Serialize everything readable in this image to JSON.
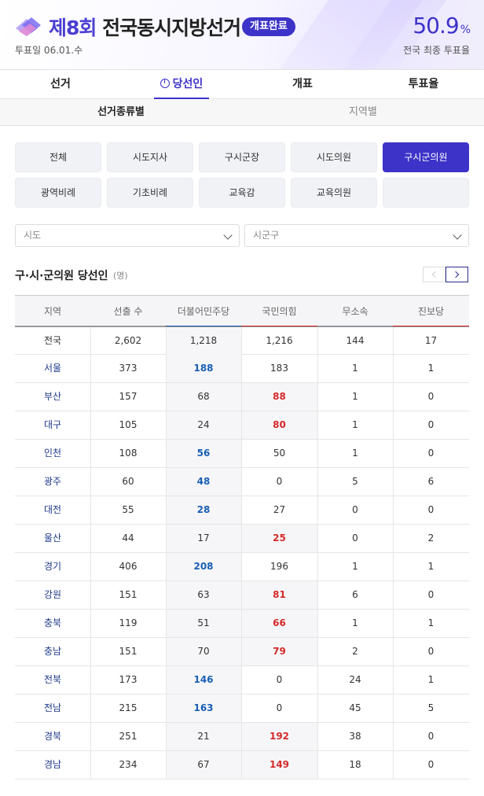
{
  "header": {
    "title_num": "제8회",
    "title_rest": " 전국동시지방선거",
    "badge": "개표완료",
    "vote_date": "투표일 06.01.수",
    "turnout_value": "50.9",
    "turnout_unit": "%",
    "turnout_label": "전국 최종 투표율"
  },
  "main_tabs": [
    "선거",
    "당선인",
    "개표",
    "투표율"
  ],
  "sub_tabs": [
    "선거종류별",
    "지역별"
  ],
  "filters": [
    "전체",
    "시도지사",
    "구시군장",
    "시도의원",
    "구시군의원",
    "광역비례",
    "기초비례",
    "교육감",
    "교육의원"
  ],
  "selects": {
    "province": "시도",
    "district": "시군구"
  },
  "section": {
    "title": "구·시·군의원 당선인",
    "unit": "(명)"
  },
  "table": {
    "headers": [
      "지역",
      "선출 수",
      "더불어민주당",
      "국민의힘",
      "무소속",
      "진보당"
    ],
    "rows": [
      [
        "전국",
        "2,602",
        "1,218",
        "1,216",
        "144",
        "17"
      ],
      [
        "서울",
        "373",
        "188",
        "183",
        "1",
        "1"
      ],
      [
        "부산",
        "157",
        "68",
        "88",
        "1",
        "0"
      ],
      [
        "대구",
        "105",
        "24",
        "80",
        "1",
        "0"
      ],
      [
        "인천",
        "108",
        "56",
        "50",
        "1",
        "0"
      ],
      [
        "광주",
        "60",
        "48",
        "0",
        "5",
        "6"
      ],
      [
        "대전",
        "55",
        "28",
        "27",
        "0",
        "0"
      ],
      [
        "울산",
        "44",
        "17",
        "25",
        "0",
        "2"
      ],
      [
        "경기",
        "406",
        "208",
        "196",
        "1",
        "1"
      ],
      [
        "강원",
        "151",
        "63",
        "81",
        "6",
        "0"
      ],
      [
        "충북",
        "119",
        "51",
        "66",
        "1",
        "1"
      ],
      [
        "충남",
        "151",
        "70",
        "79",
        "2",
        "0"
      ],
      [
        "전북",
        "173",
        "146",
        "0",
        "24",
        "1"
      ],
      [
        "전남",
        "215",
        "163",
        "0",
        "45",
        "5"
      ],
      [
        "경북",
        "251",
        "21",
        "192",
        "38",
        "0"
      ],
      [
        "경남",
        "234",
        "67",
        "149",
        "18",
        "0"
      ]
    ],
    "winner_party": [
      "none",
      "dem",
      "ppp",
      "ppp",
      "dem",
      "dem",
      "dem",
      "ppp",
      "dem",
      "ppp",
      "ppp",
      "ppp",
      "dem",
      "dem",
      "ppp",
      "ppp"
    ]
  },
  "colors": {
    "accent": "#3d33c8",
    "dem": "#1a5fb4",
    "ppp": "#d42a2a",
    "independent": "#8a8fa8",
    "progressive": "#d42a2a"
  },
  "icons": {
    "logo": "election-logo-icon",
    "winner": "winner-icon",
    "chevron": "chevron-down-icon",
    "prev": "chevron-left-icon",
    "next": "chevron-right-icon"
  }
}
